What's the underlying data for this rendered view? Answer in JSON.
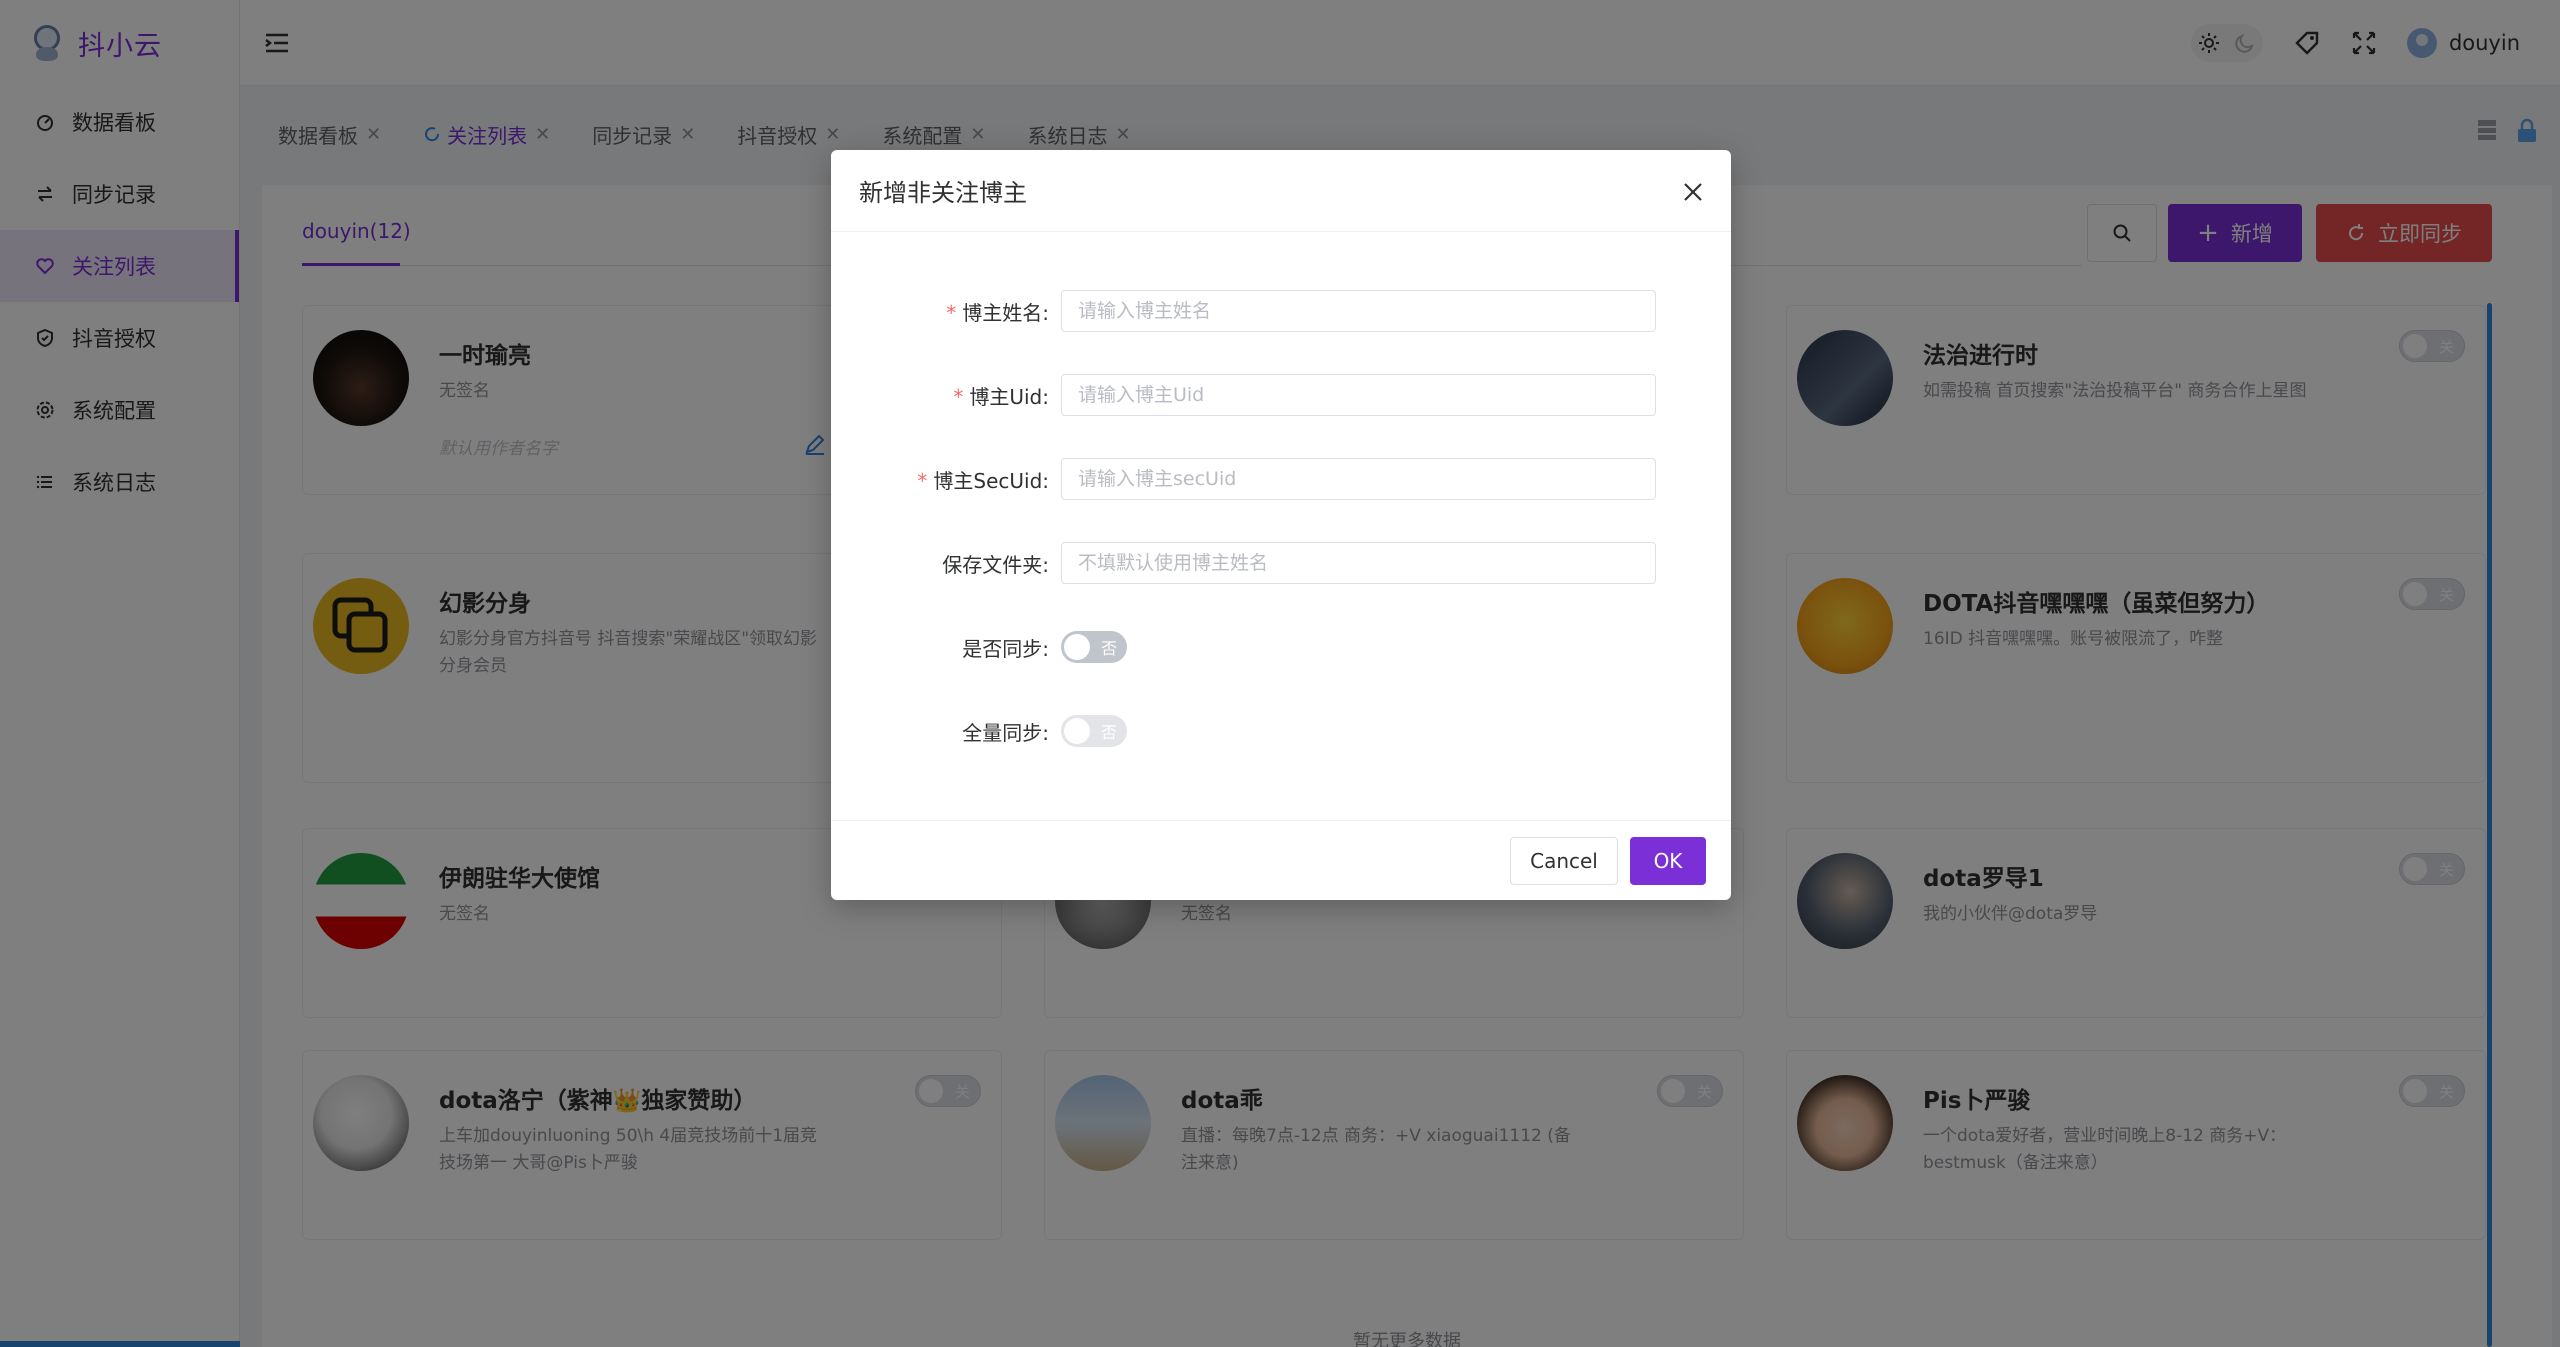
{
  "app": {
    "title": "抖小云"
  },
  "sidebar": {
    "items": [
      {
        "label": "数据看板",
        "icon": "dashboard-icon"
      },
      {
        "label": "同步记录",
        "icon": "swap-icon"
      },
      {
        "label": "关注列表",
        "icon": "heart-icon",
        "active": true
      },
      {
        "label": "抖音授权",
        "icon": "shield-icon"
      },
      {
        "label": "系统配置",
        "icon": "gear-icon"
      },
      {
        "label": "系统日志",
        "icon": "list-icon"
      }
    ]
  },
  "header": {
    "username": "douyin"
  },
  "tabs": [
    {
      "label": "数据看板"
    },
    {
      "label": "关注列表",
      "active": true
    },
    {
      "label": "同步记录"
    },
    {
      "label": "抖音授权"
    },
    {
      "label": "系统配置"
    },
    {
      "label": "系统日志"
    }
  ],
  "content": {
    "account_tab": "douyin(12)",
    "add_label": "新增",
    "sync_label": "立即同步",
    "no_more": "暂无更多数据"
  },
  "cards": [
    {
      "name": "一时瑜亮",
      "signature": "无签名",
      "alias_placeholder": "默认用作者名字"
    },
    {
      "name": "法治进行时",
      "signature": "如需投稿 首页搜索\"法治投稿平台\" 商务合作上星图",
      "switch": "关"
    },
    {
      "name": "幻影分身",
      "signature": "幻影分身官方抖音号 抖音搜索\"荣耀战区\"领取幻影分身会员"
    },
    {
      "name": "DOTA抖音嘿嘿嘿（虽菜但努力）",
      "signature": "16ID 抖音嘿嘿嘿。账号被限流了，咋整",
      "switch": "关"
    },
    {
      "name": "伊朗驻华大使馆",
      "signature": "无签名"
    },
    {
      "name": "",
      "signature": "无签名"
    },
    {
      "name": "dota罗导1",
      "signature": "我的小伙伴@dota罗导",
      "switch": "关"
    },
    {
      "name": "dota洛宁（紫神👑独家赞助）",
      "signature": "上车加douyinluoning 50\\h 4届竞技场前十1届竞技场第一 大哥@Pis卜严骏",
      "switch": "关"
    },
    {
      "name": "dota乖",
      "signature": "直播：每晚7点-12点 商务：+V xiaoguai1112 (备注来意)",
      "switch": "关"
    },
    {
      "name": "Pis卜严骏",
      "signature": "一个dota爱好者，营业时间晚上8-12 商务+V：bestmusk（备注来意）",
      "switch": "关"
    }
  ],
  "modal": {
    "title": "新增非关注博主",
    "fields": {
      "name": {
        "label": "博主姓名:",
        "placeholder": "请输入博主姓名",
        "required": true
      },
      "uid": {
        "label": "博主Uid:",
        "placeholder": "请输入博主Uid",
        "required": true
      },
      "secuid": {
        "label": "博主SecUid:",
        "placeholder": "请输入博主secUid",
        "required": true
      },
      "folder": {
        "label": "保存文件夹:",
        "placeholder": "不填默认使用博主姓名"
      },
      "sync": {
        "label": "是否同步:",
        "value": "否"
      },
      "full_sync": {
        "label": "全量同步:",
        "value": "否",
        "disabled": true
      }
    },
    "cancel_label": "Cancel",
    "ok_label": "OK"
  },
  "colors": {
    "primary": "#7b2fd6",
    "danger": "#e84a4a",
    "accent_blue": "#2e86de"
  }
}
